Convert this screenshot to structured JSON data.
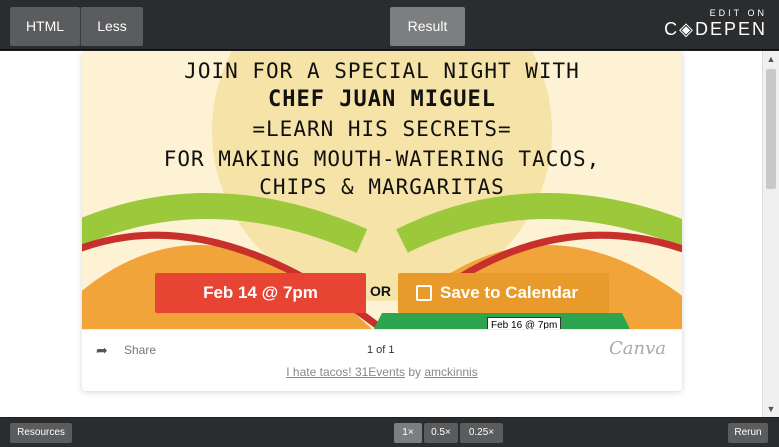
{
  "editor": {
    "tabs": [
      {
        "label": "HTML"
      },
      {
        "label": "Less"
      }
    ],
    "result_label": "Result",
    "logo": {
      "edit": "EDIT ON",
      "name": "C◈DEPEN"
    }
  },
  "poster": {
    "line1": "JOIN FOR A SPECIAL NIGHT WITH",
    "line2": "CHEF JUAN MIGUEL",
    "line3": "=LEARN HIS SECRETS=",
    "line4": "FOR MAKING MOUTH-WATERING TACOS,",
    "line5": "CHIPS & MARGARITAS",
    "date_button": "Feb 14 @ 7pm",
    "or_text": "OR",
    "calendar_button": "Save to Calendar",
    "tooltip": "Feb 16 @ 7pm",
    "colors": {
      "background": "#fdf2d4",
      "date_button": "#e84434",
      "calendar_button": "#e89a2a",
      "taco_shell": "#f0a43a",
      "lettuce": "#9cc93b",
      "tomato": "#c8302c"
    }
  },
  "share_bar": {
    "share_label": "Share",
    "pager": "1 of 1",
    "brand": "Canva"
  },
  "credit": {
    "title": "I hate tacos! 31Events",
    "by": "by",
    "author": "amckinnis"
  },
  "footer": {
    "resources": "Resources",
    "zoom": [
      "1×",
      "0.5×",
      "0.25×"
    ],
    "rerun": "Rerun"
  }
}
